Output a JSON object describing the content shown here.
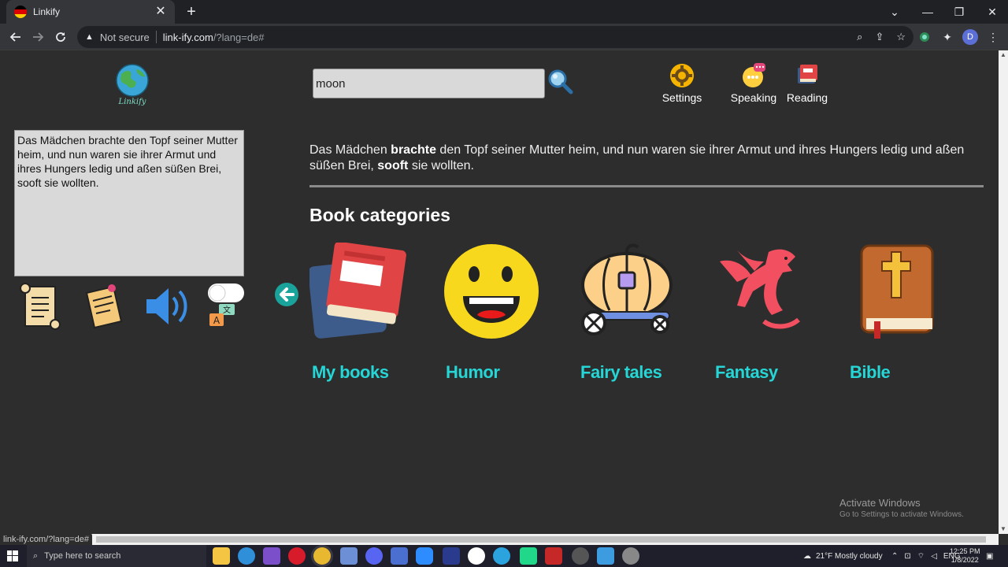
{
  "browser": {
    "tab_title": "Linkify",
    "tab_close": "✕",
    "new_tab": "+",
    "not_secure": "Not secure",
    "url_host": "link-ify.com",
    "url_path": "/?lang=de#",
    "profile_initial": "D",
    "status_url": "link-ify.com/?lang=de#"
  },
  "site": {
    "logo_text": "Linkify",
    "search": {
      "value": "moon"
    },
    "nav": [
      {
        "label": "Settings",
        "icon": "gear-icon"
      },
      {
        "label": "Speaking",
        "icon": "speech-bubble-icon"
      },
      {
        "label": "Reading",
        "icon": "book-icon"
      }
    ],
    "input_text": "Das Mädchen brachte den Topf seiner Mutter heim, und nun waren sie ihrer Armut und ihres Hungers ledig und aßen süßen Brei, sooft sie wollten.",
    "sentence": {
      "p1": "Das Mädchen ",
      "b1": "brachte",
      "p2": " den Topf seiner Mutter heim, und nun waren sie ihrer Armut und ihres Hungers ledig und aßen süßen Brei, ",
      "b2": "sooft",
      "p3": " sie wollten."
    },
    "tools": [
      {
        "icon": "scroll-icon"
      },
      {
        "icon": "note-icon"
      },
      {
        "icon": "speaker-icon"
      },
      {
        "icon": "translate-icon"
      }
    ],
    "categories_title": "Book categories",
    "categories": [
      {
        "label": "My books",
        "icon": "books-icon"
      },
      {
        "label": "Humor",
        "icon": "smiley-icon"
      },
      {
        "label": "Fairy tales",
        "icon": "pumpkin-carriage-icon"
      },
      {
        "label": "Fantasy",
        "icon": "dragon-icon"
      },
      {
        "label": "Bible",
        "icon": "bible-icon"
      }
    ]
  },
  "windows": {
    "watermark_title": "Activate Windows",
    "watermark_sub": "Go to Settings to activate Windows.",
    "search_placeholder": "Type here to search",
    "weather": "21°F  Mostly cloudy",
    "lang": "ENG",
    "time": "12:25 PM",
    "date": "1/8/2022"
  },
  "colors": {
    "accent_cyan": "#26d6d6",
    "page_bg": "#2d2d2d",
    "input_bg": "#d9d9d9"
  }
}
